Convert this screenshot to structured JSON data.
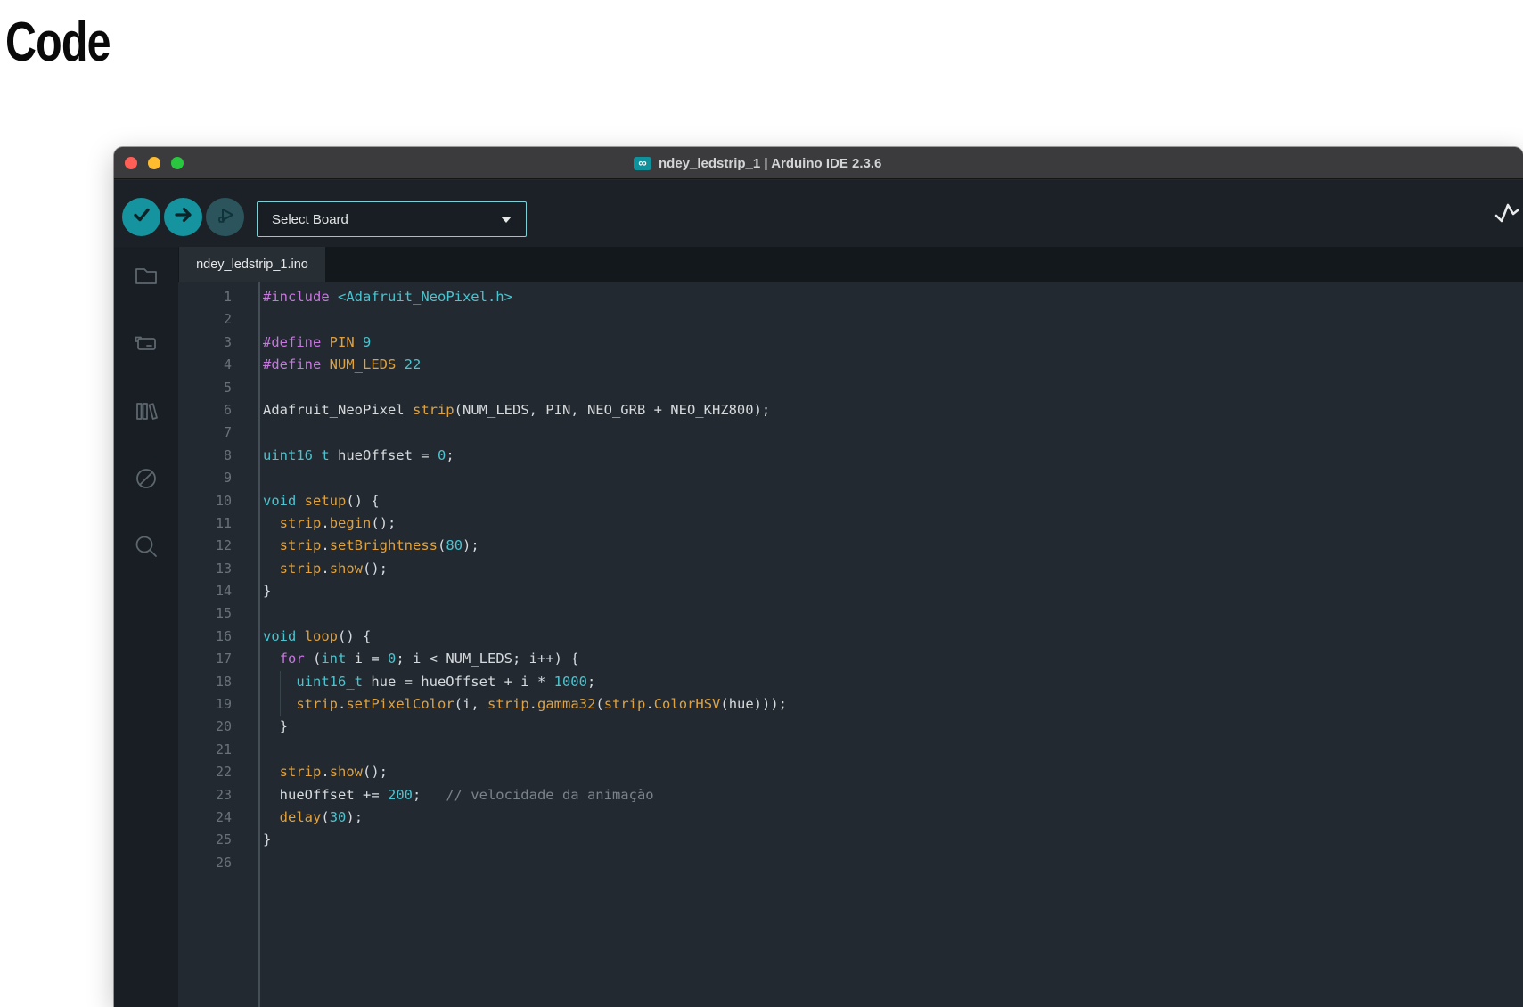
{
  "heading": "Code",
  "window": {
    "title": "ndey_ledstrip_1 | Arduino IDE 2.3.6",
    "logo_glyph": "∞"
  },
  "toolbar": {
    "board_selector_label": "Select Board",
    "icons": [
      "verify-icon",
      "upload-icon",
      "debug-icon",
      "serial-plotter-icon"
    ]
  },
  "sidebar": {
    "icons": [
      "sketchbook-folder-icon",
      "boards-manager-icon",
      "library-manager-icon",
      "debug-disabled-icon",
      "search-icon"
    ]
  },
  "tab": {
    "label": "ndey_ledstrip_1.ino"
  },
  "colors": {
    "accent_teal": "#15939e",
    "keyword": "#c678dd",
    "constant": "#4cc3ce",
    "function": "#e0a23e",
    "plain": "#d6dadd",
    "comment": "#7b838a",
    "traffic_red": "#ff5f57",
    "traffic_yellow": "#febc2e",
    "traffic_green": "#29c73f"
  },
  "editor": {
    "lines": [
      {
        "n": 1,
        "segs": [
          [
            "k",
            "#include"
          ],
          [
            "w",
            " "
          ],
          [
            "c",
            "<Adafruit_NeoPixel.h>"
          ]
        ]
      },
      {
        "n": 2,
        "segs": []
      },
      {
        "n": 3,
        "segs": [
          [
            "k",
            "#define"
          ],
          [
            "w",
            " "
          ],
          [
            "f",
            "PIN"
          ],
          [
            "w",
            " "
          ],
          [
            "c",
            "9"
          ]
        ]
      },
      {
        "n": 4,
        "segs": [
          [
            "k",
            "#define"
          ],
          [
            "w",
            " "
          ],
          [
            "f",
            "NUM_LEDS"
          ],
          [
            "w",
            " "
          ],
          [
            "c",
            "22"
          ]
        ]
      },
      {
        "n": 5,
        "segs": []
      },
      {
        "n": 6,
        "segs": [
          [
            "w",
            "Adafruit_NeoPixel "
          ],
          [
            "f",
            "strip"
          ],
          [
            "w",
            "(NUM_LEDS, PIN, NEO_GRB + NEO_KHZ800);"
          ]
        ]
      },
      {
        "n": 7,
        "segs": []
      },
      {
        "n": 8,
        "segs": [
          [
            "c",
            "uint16_t"
          ],
          [
            "w",
            " hueOffset = "
          ],
          [
            "c",
            "0"
          ],
          [
            "w",
            ";"
          ]
        ]
      },
      {
        "n": 9,
        "segs": []
      },
      {
        "n": 10,
        "segs": [
          [
            "c",
            "void"
          ],
          [
            "w",
            " "
          ],
          [
            "f",
            "setup"
          ],
          [
            "w",
            "() {"
          ]
        ]
      },
      {
        "n": 11,
        "segs": [
          [
            "w",
            "  "
          ],
          [
            "f",
            "strip"
          ],
          [
            "w",
            "."
          ],
          [
            "f",
            "begin"
          ],
          [
            "w",
            "();"
          ]
        ]
      },
      {
        "n": 12,
        "segs": [
          [
            "w",
            "  "
          ],
          [
            "f",
            "strip"
          ],
          [
            "w",
            "."
          ],
          [
            "f",
            "setBrightness"
          ],
          [
            "w",
            "("
          ],
          [
            "c",
            "80"
          ],
          [
            "w",
            ");"
          ]
        ]
      },
      {
        "n": 13,
        "segs": [
          [
            "w",
            "  "
          ],
          [
            "f",
            "strip"
          ],
          [
            "w",
            "."
          ],
          [
            "f",
            "show"
          ],
          [
            "w",
            "();"
          ]
        ]
      },
      {
        "n": 14,
        "segs": [
          [
            "w",
            "}"
          ]
        ]
      },
      {
        "n": 15,
        "segs": []
      },
      {
        "n": 16,
        "segs": [
          [
            "c",
            "void"
          ],
          [
            "w",
            " "
          ],
          [
            "f",
            "loop"
          ],
          [
            "w",
            "() {"
          ]
        ]
      },
      {
        "n": 17,
        "segs": [
          [
            "w",
            "  "
          ],
          [
            "k",
            "for"
          ],
          [
            "w",
            " ("
          ],
          [
            "c",
            "int"
          ],
          [
            "w",
            " i = "
          ],
          [
            "c",
            "0"
          ],
          [
            "w",
            "; i < NUM_LEDS; i++) {"
          ]
        ]
      },
      {
        "n": 18,
        "segs": [
          [
            "w",
            "    "
          ],
          [
            "c",
            "uint16_t"
          ],
          [
            "w",
            " hue = hueOffset + i * "
          ],
          [
            "c",
            "1000"
          ],
          [
            "w",
            ";"
          ]
        ]
      },
      {
        "n": 19,
        "segs": [
          [
            "w",
            "    "
          ],
          [
            "f",
            "strip"
          ],
          [
            "w",
            "."
          ],
          [
            "f",
            "setPixelColor"
          ],
          [
            "w",
            "(i, "
          ],
          [
            "f",
            "strip"
          ],
          [
            "w",
            "."
          ],
          [
            "f",
            "gamma32"
          ],
          [
            "w",
            "("
          ],
          [
            "f",
            "strip"
          ],
          [
            "w",
            "."
          ],
          [
            "f",
            "ColorHSV"
          ],
          [
            "w",
            "(hue)));"
          ]
        ]
      },
      {
        "n": 20,
        "segs": [
          [
            "w",
            "  }"
          ]
        ]
      },
      {
        "n": 21,
        "segs": []
      },
      {
        "n": 22,
        "segs": [
          [
            "w",
            "  "
          ],
          [
            "f",
            "strip"
          ],
          [
            "w",
            "."
          ],
          [
            "f",
            "show"
          ],
          [
            "w",
            "();"
          ]
        ]
      },
      {
        "n": 23,
        "segs": [
          [
            "w",
            "  hueOffset += "
          ],
          [
            "c",
            "200"
          ],
          [
            "w",
            ";   "
          ],
          [
            "m",
            "// velocidade da animação"
          ]
        ]
      },
      {
        "n": 24,
        "segs": [
          [
            "w",
            "  "
          ],
          [
            "f",
            "delay"
          ],
          [
            "w",
            "("
          ],
          [
            "c",
            "30"
          ],
          [
            "w",
            ");"
          ]
        ]
      },
      {
        "n": 25,
        "segs": [
          [
            "w",
            "}"
          ]
        ]
      },
      {
        "n": 26,
        "segs": []
      }
    ]
  }
}
